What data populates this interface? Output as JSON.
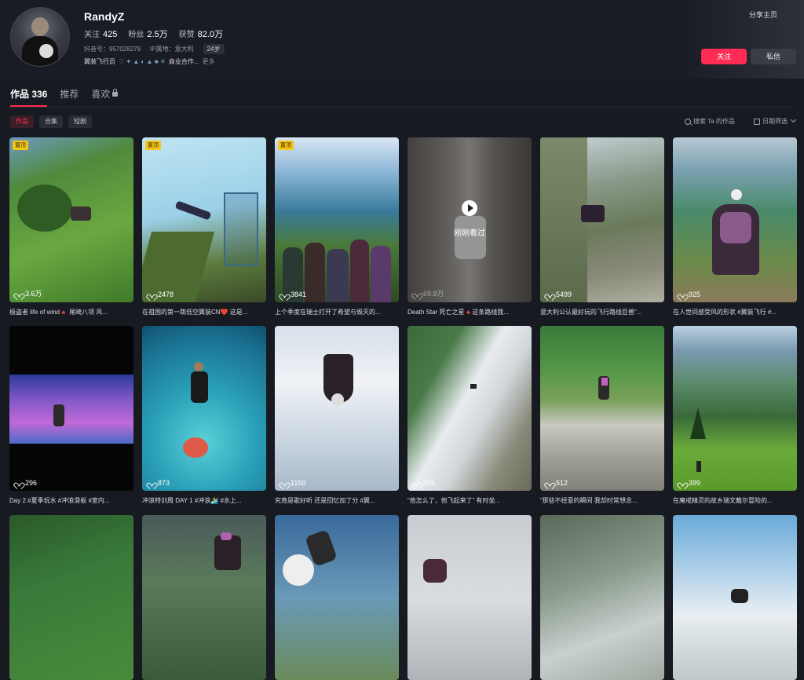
{
  "profile": {
    "username": "RandyZ",
    "stats": [
      {
        "label": "关注",
        "value": "425"
      },
      {
        "label": "粉丝",
        "value": "2.5万"
      },
      {
        "label": "获赞",
        "value": "82.0万"
      }
    ],
    "douyin_id": "抖音号：957028279",
    "ip_location": "IP属地：意大利",
    "age": "24岁",
    "bio": "翼装飞行员",
    "bio_business": "商业合作...",
    "bio_more": "更多"
  },
  "header_actions": {
    "share_home": "分享主页",
    "follow": "关注",
    "message": "私信"
  },
  "tabs": [
    {
      "label": "作品 336",
      "active": true
    },
    {
      "label": "推荐",
      "active": false
    },
    {
      "label": "喜欢",
      "active": false
    }
  ],
  "subtabs": [
    {
      "label": "作品",
      "active": true
    },
    {
      "label": "合集",
      "active": false
    },
    {
      "label": "短剧",
      "active": false
    }
  ],
  "search_works": "搜索 Ta 的作品",
  "date_filter": "日期筛选",
  "videos": [
    {
      "likes": "3.6万",
      "caption": "极盗者 life of wind🔺 尾崎八项 风...",
      "pinned": true
    },
    {
      "likes": "2478",
      "caption": "在祖国的第一跳低空翼装CN❤️ 这是...",
      "pinned": true
    },
    {
      "likes": "3841",
      "caption": "上个季度在瑞士打开了希望与毁灭的...",
      "pinned": true
    },
    {
      "likes": "69.8万",
      "caption": "Death Star 死亡之星🔺这条路线我...",
      "pinned": false,
      "watched_label": "刚刚看过"
    },
    {
      "likes": "5499",
      "caption": "意大利公认最好玩的飞行路线巨兽\"...",
      "pinned": false
    },
    {
      "likes": "925",
      "caption": "在人世间感受风的形状 #翼装飞行 #...",
      "pinned": false
    },
    {
      "likes": "296",
      "caption": "Day 2 #夏季玩水 #冲浪滑板 #室内...",
      "pinned": false
    },
    {
      "likes": "873",
      "caption": "冲浪特训周 DAY 1 #冲浪🏄 #水上...",
      "pinned": false
    },
    {
      "likes": "1159",
      "caption": "究竟是歌好听 还是回忆加了分 #翼...",
      "pinned": false
    },
    {
      "likes": "905",
      "caption": "“他怎么了，他飞起来了” 有时坐...",
      "pinned": false
    },
    {
      "likes": "512",
      "caption": "“那些不经意的瞬间 我却时常想念...",
      "pinned": false
    },
    {
      "likes": "399",
      "caption": "在魔戒精灵的故乡瑞文戴尔冒险的...",
      "pinned": false
    },
    {
      "likes": "",
      "caption": "",
      "pinned": false
    },
    {
      "likes": "",
      "caption": "",
      "pinned": false
    },
    {
      "likes": "",
      "caption": "",
      "pinned": false
    },
    {
      "likes": "",
      "caption": "",
      "pinned": false
    },
    {
      "likes": "",
      "caption": "",
      "pinned": false
    },
    {
      "likes": "",
      "caption": "",
      "pinned": false
    }
  ],
  "pin_label": "置顶",
  "colors": {
    "accent": "#fe2c55",
    "background": "#181a22",
    "pin": "#f5c518"
  }
}
